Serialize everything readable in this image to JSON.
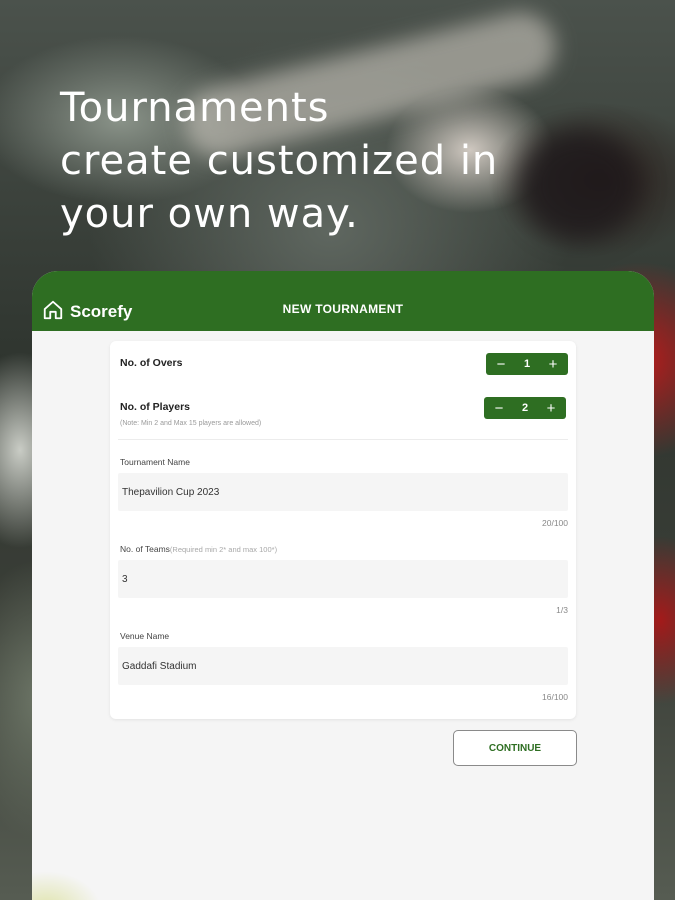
{
  "headline": {
    "line1": "Tournaments",
    "line2": "create customized in",
    "line3": "your own way."
  },
  "appbar": {
    "brand": "Scorefy",
    "brand_icon": "home-icon",
    "title": "NEW TOURNAMENT"
  },
  "form": {
    "overs": {
      "label": "No. of Overs",
      "value": "1",
      "minus": "−",
      "plus": "+"
    },
    "players": {
      "label": "No. of Players",
      "note": "(Note: Min 2 and Max 15 players are allowed)",
      "value": "2",
      "minus": "−",
      "plus": "+"
    },
    "tournament_name": {
      "label": "Tournament Name",
      "value": "Thepavilion Cup 2023",
      "counter": "20/100"
    },
    "teams": {
      "label": "No. of Teams",
      "hint": "(Required min 2* and max 100*)",
      "value": "3",
      "counter": "1/3"
    },
    "venue": {
      "label": "Venue Name",
      "value": "Gaddafi Stadium",
      "counter": "16/100"
    }
  },
  "actions": {
    "continue_label": "CONTINUE"
  },
  "colors": {
    "brand_green": "#2e6e22",
    "panel_bg": "#f5f5f5"
  }
}
